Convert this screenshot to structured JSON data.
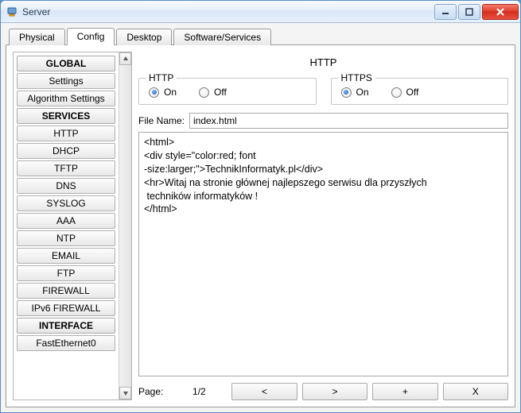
{
  "window": {
    "title": "Server"
  },
  "tabs": {
    "items": [
      {
        "label": "Physical"
      },
      {
        "label": "Config"
      },
      {
        "label": "Desktop"
      },
      {
        "label": "Software/Services"
      }
    ]
  },
  "sidebar": {
    "global_header": "GLOBAL",
    "global_items": [
      {
        "label": "Settings"
      },
      {
        "label": "Algorithm Settings"
      }
    ],
    "services_header": "SERVICES",
    "services_items": [
      {
        "label": "HTTP"
      },
      {
        "label": "DHCP"
      },
      {
        "label": "TFTP"
      },
      {
        "label": "DNS"
      },
      {
        "label": "SYSLOG"
      },
      {
        "label": "AAA"
      },
      {
        "label": "NTP"
      },
      {
        "label": "EMAIL"
      },
      {
        "label": "FTP"
      },
      {
        "label": "FIREWALL"
      },
      {
        "label": "IPv6 FIREWALL"
      }
    ],
    "interface_header": "INTERFACE",
    "interface_items": [
      {
        "label": "FastEthernet0"
      }
    ]
  },
  "main": {
    "title": "HTTP",
    "http_legend": "HTTP",
    "https_legend": "HTTPS",
    "on_label": "On",
    "off_label": "Off",
    "file_label": "File Name:",
    "file_value": "index.html",
    "editor_text": "<html>\n<div style=\"color:red; font\n-size:larger;\">TechnikInformatyk.pl</div>\n<hr>Witaj na stronie głównej najlepszego serwisu dla przyszłych\n techników informatyków !\n</html>",
    "page_label": "Page:",
    "page_value": "1/2",
    "btn_prev": "<",
    "btn_next": ">",
    "btn_add": "+",
    "btn_del": "X"
  }
}
